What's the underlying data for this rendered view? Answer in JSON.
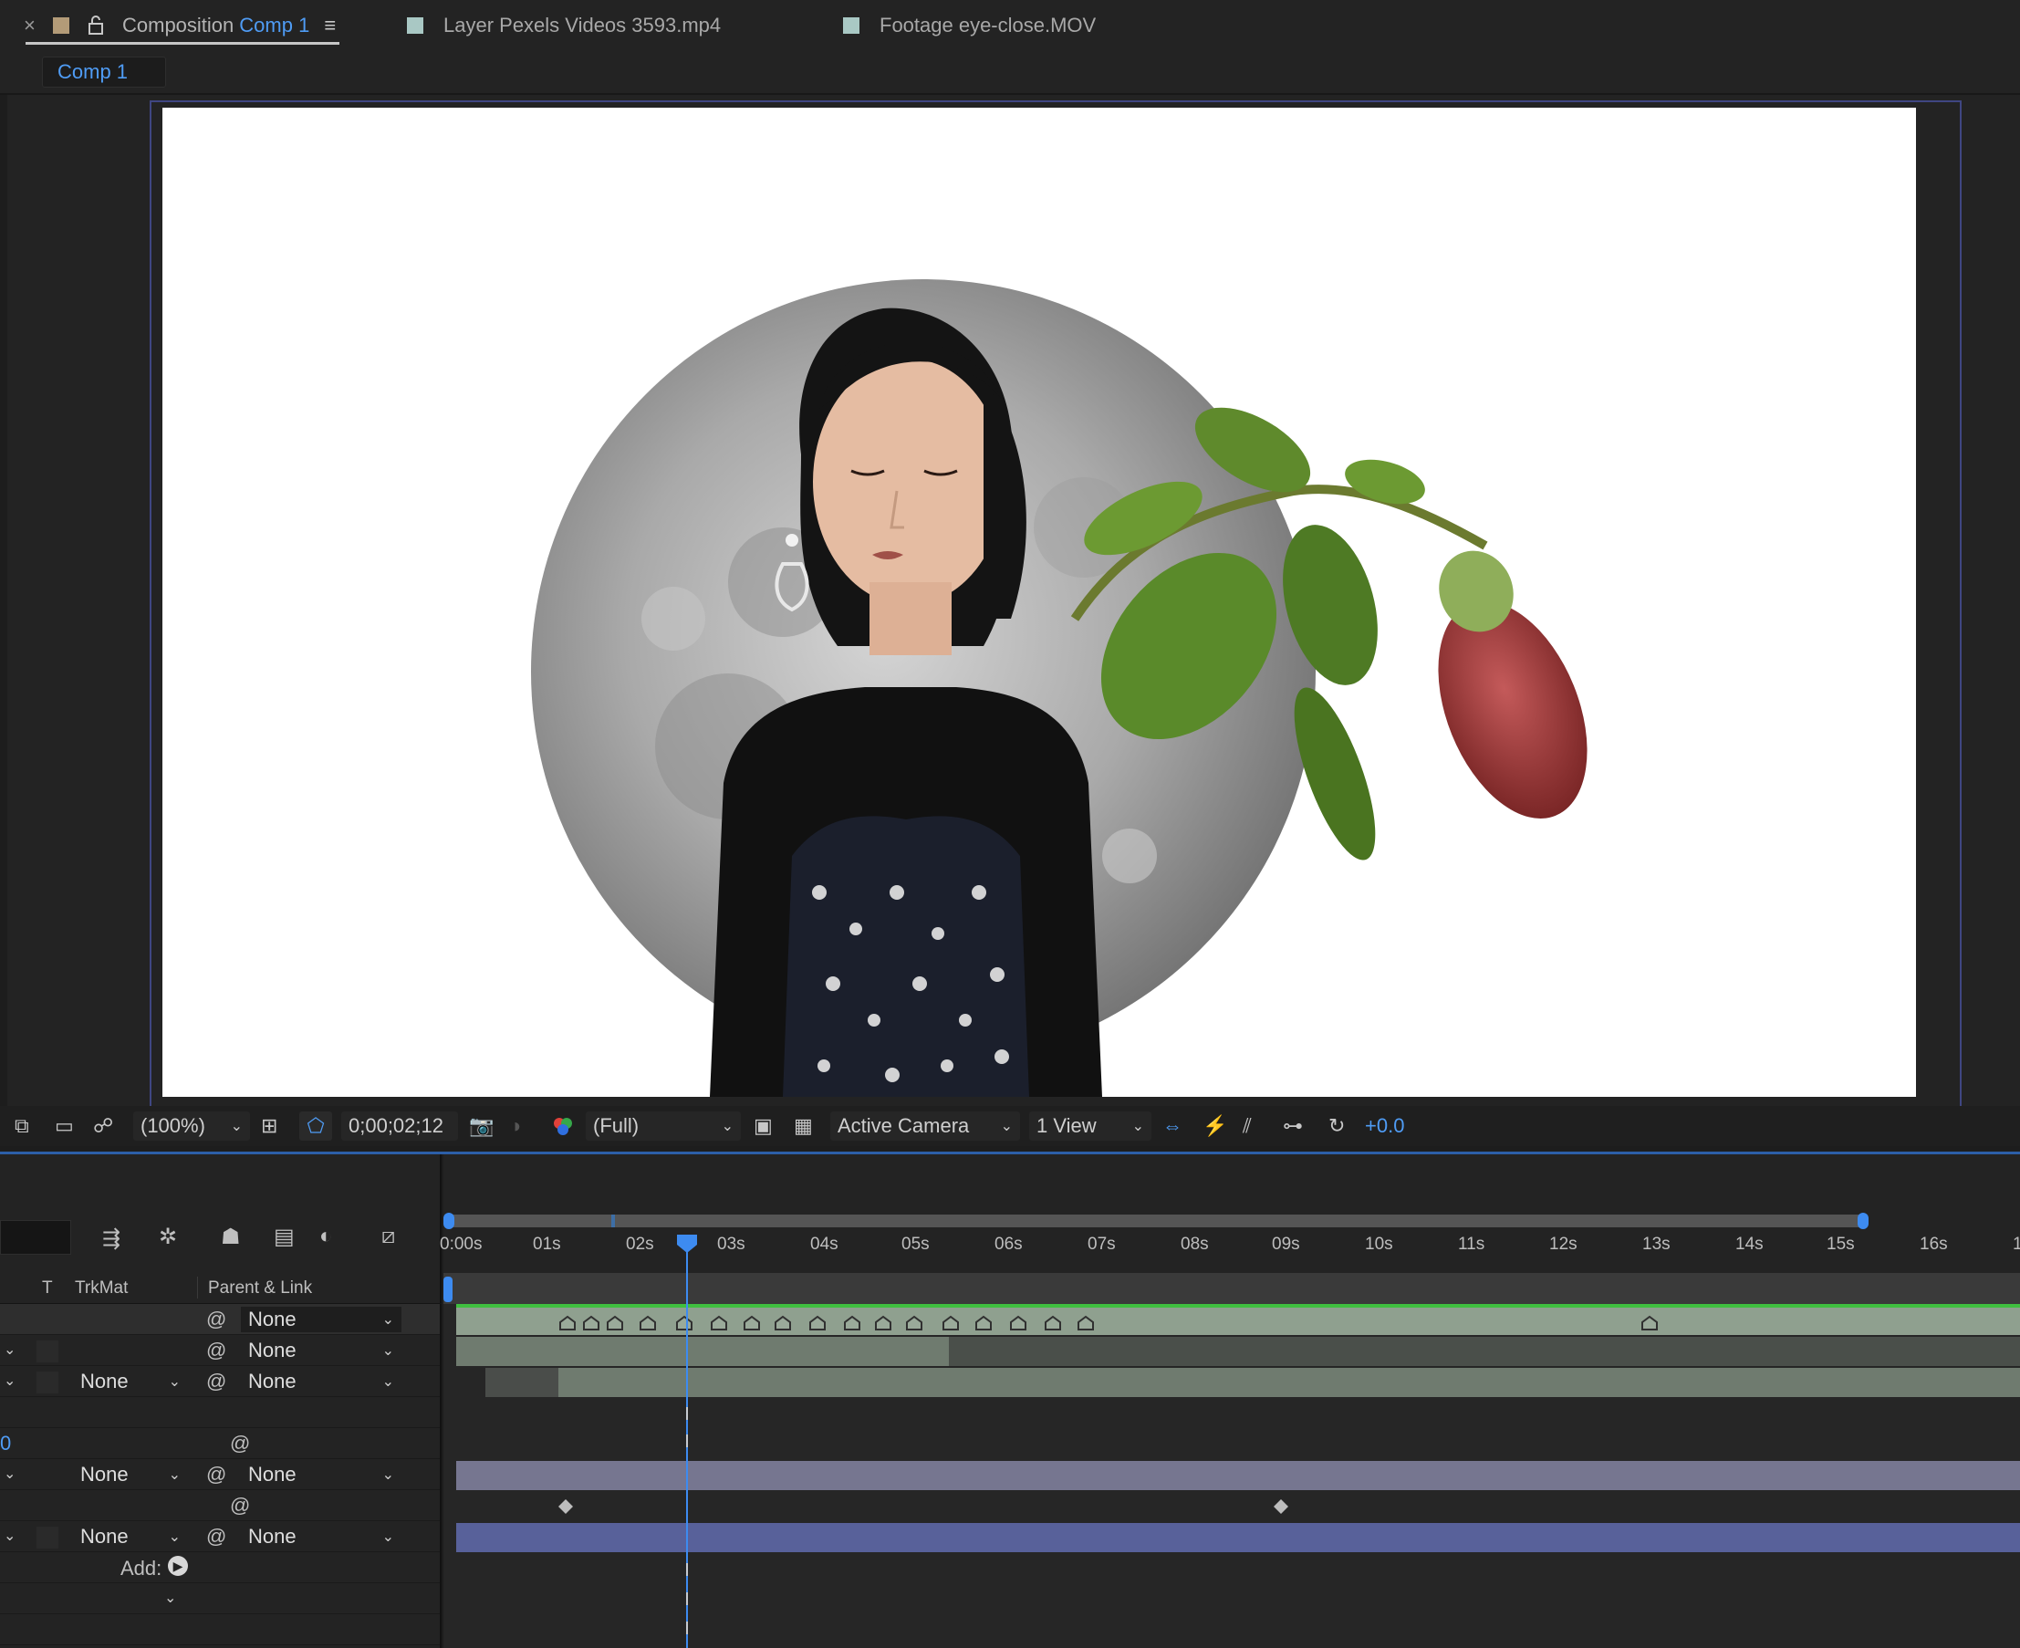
{
  "tabs": {
    "close": "×",
    "composition_prefix": "Composition",
    "composition_name": "Comp 1",
    "menu": "≡",
    "layer_tab": "Layer Pexels Videos 3593.mp4",
    "footage_tab": "Footage eye-close.MOV"
  },
  "breadcrumb": {
    "label": "Comp 1"
  },
  "viewer_toolbar": {
    "zoom": "(100%)",
    "timecode": "0;00;02;12",
    "resolution": "(Full)",
    "camera": "Active Camera",
    "views": "1 View",
    "exposure": "+0.0"
  },
  "timeline": {
    "headers": {
      "t": "T",
      "trkmat": "TrkMat",
      "parent": "Parent & Link"
    },
    "ruler_ticks": [
      "0:00s",
      "01s",
      "02s",
      "03s",
      "04s",
      "05s",
      "06s",
      "07s",
      "08s",
      "09s",
      "10s",
      "11s",
      "12s",
      "13s",
      "14s",
      "15s",
      "16s",
      "1"
    ],
    "layer_rows": [
      {
        "trkmat": "",
        "parent": "None"
      },
      {
        "trkmat": "",
        "parent": "None"
      },
      {
        "trkmat": "None",
        "parent": "None"
      },
      {
        "trkmat": "",
        "parent": ""
      },
      {
        "trkmat": "",
        "parent": ""
      },
      {
        "trkmat": "None",
        "parent": "None"
      },
      {
        "trkmat": "",
        "parent": ""
      },
      {
        "trkmat": "None",
        "parent": "None"
      }
    ],
    "value_fragment": "0",
    "add_label": "Add:"
  },
  "colors": {
    "accent_blue": "#3d8bf0",
    "composition_swatch": "#b39b78",
    "layer_swatch": "#a9c8c4",
    "track_green": "#8fa08f",
    "track_purple": "#7a7a96",
    "track_blue": "#5d6aa0"
  }
}
